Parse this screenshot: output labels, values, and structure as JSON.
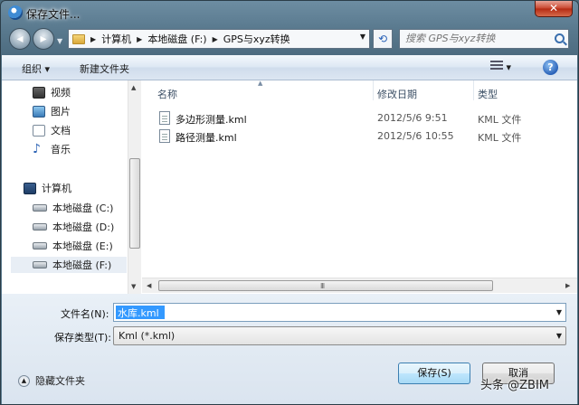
{
  "window": {
    "title": "保存文件...",
    "close_label": "✕"
  },
  "nav": {
    "breadcrumbs": [
      "计算机",
      "本地磁盘 (F:)",
      "GPS与xyz转换"
    ],
    "search_placeholder": "搜索 GPS与xyz转换"
  },
  "toolbar": {
    "organize_label": "组织 ▾",
    "new_folder_label": "新建文件夹",
    "view_label": "▾",
    "help_label": "?"
  },
  "sidebar": {
    "libraries": [
      "视频",
      "图片",
      "文档",
      "音乐"
    ],
    "computer": "计算机",
    "drives": [
      "本地磁盘 (C:)",
      "本地磁盘 (D:)",
      "本地磁盘 (E:)",
      "本地磁盘 (F:)"
    ],
    "selected_drive": "本地磁盘 (F:)"
  },
  "filelist": {
    "columns": {
      "name": "名称",
      "date": "修改日期",
      "type": "类型"
    },
    "rows": [
      {
        "name": "多边形测量.kml",
        "date": "2012/5/6 9:51",
        "type": "KML 文件"
      },
      {
        "name": "路径测量.kml",
        "date": "2012/5/6 10:55",
        "type": "KML 文件"
      }
    ],
    "scroll_grip": "III"
  },
  "form": {
    "filename_label": "文件名(N):",
    "filename_value": "水库.kml",
    "filetype_label": "保存类型(T):",
    "filetype_value": "Kml (*.kml)",
    "hide_folders_label": "隐藏文件夹",
    "save_label": "保存(S)",
    "cancel_label": "取消"
  },
  "watermark": "头条 @ZBIM"
}
